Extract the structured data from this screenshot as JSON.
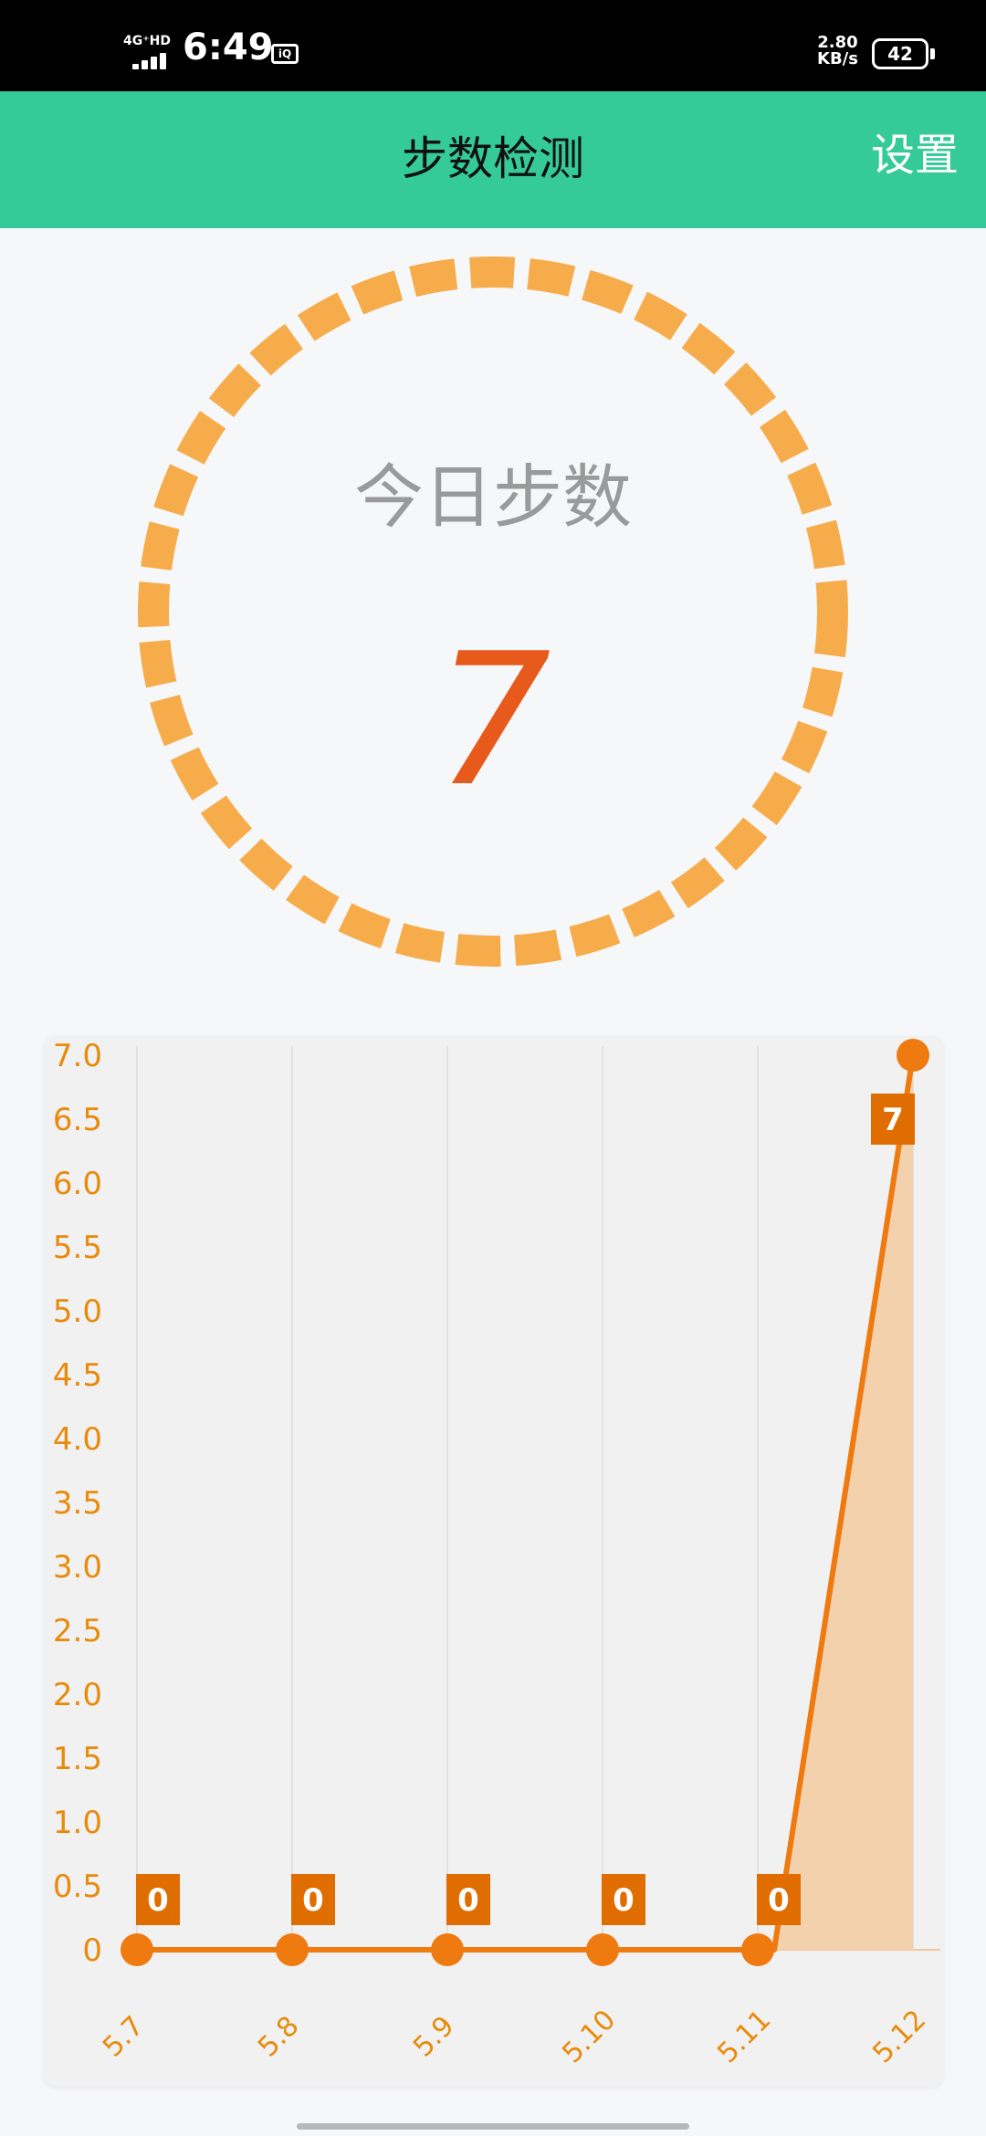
{
  "status_bar": {
    "network": "4G⁺HD",
    "time": "6:49",
    "app_icon_text": "iQIYI",
    "speed_value": "2.80",
    "speed_unit": "KB/s",
    "battery": "42"
  },
  "app_bar": {
    "title": "步数检测",
    "settings_label": "设置"
  },
  "today": {
    "label": "今日步数",
    "steps": "7"
  },
  "colors": {
    "accent": "#34cb98",
    "ring": "#f7ac4b",
    "steps_value": "#e8591c",
    "line": "#ee7a10",
    "tag": "#e06d00",
    "fill": "#f4cda5",
    "axis_text": "#e88a0a"
  },
  "chart_data": {
    "type": "line",
    "categories": [
      "5.7",
      "5.8",
      "5.9",
      "5.10",
      "5.11",
      "5.12"
    ],
    "series": [
      {
        "values": [
          0,
          0,
          0,
          0,
          0,
          7
        ]
      }
    ],
    "data_labels": [
      "0",
      "0",
      "0",
      "0",
      "0",
      "7"
    ],
    "ylim": [
      0,
      7
    ],
    "yticks": [
      "0",
      "0.5",
      "1.0",
      "1.5",
      "2.0",
      "2.5",
      "3.0",
      "3.5",
      "4.0",
      "4.5",
      "5.0",
      "5.5",
      "6.0",
      "6.5",
      "7.0"
    ],
    "grid": "vertical",
    "area_fill": "last segment"
  }
}
